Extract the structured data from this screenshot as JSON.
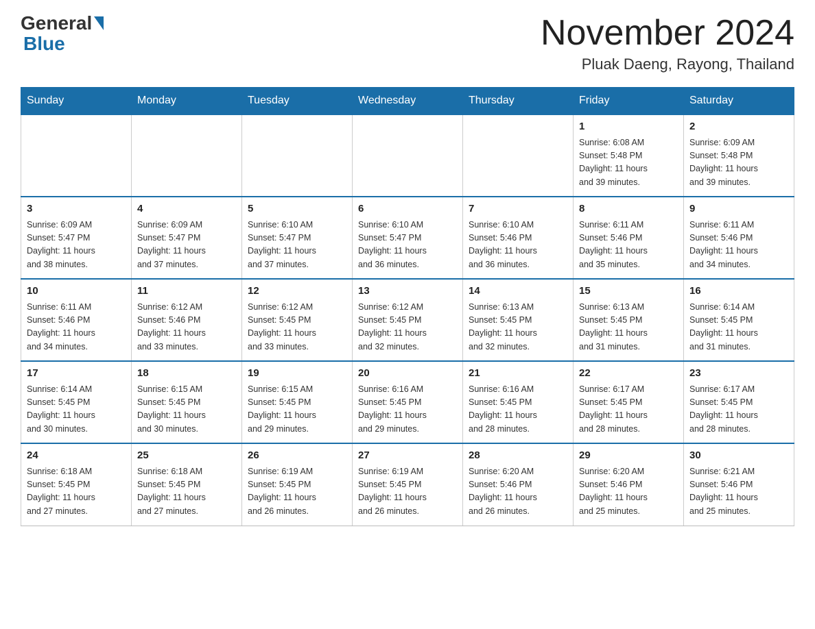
{
  "header": {
    "logo_general": "General",
    "logo_blue": "Blue",
    "month_title": "November 2024",
    "location": "Pluak Daeng, Rayong, Thailand"
  },
  "weekdays": [
    "Sunday",
    "Monday",
    "Tuesday",
    "Wednesday",
    "Thursday",
    "Friday",
    "Saturday"
  ],
  "weeks": [
    [
      {
        "day": "",
        "info": ""
      },
      {
        "day": "",
        "info": ""
      },
      {
        "day": "",
        "info": ""
      },
      {
        "day": "",
        "info": ""
      },
      {
        "day": "",
        "info": ""
      },
      {
        "day": "1",
        "info": "Sunrise: 6:08 AM\nSunset: 5:48 PM\nDaylight: 11 hours\nand 39 minutes."
      },
      {
        "day": "2",
        "info": "Sunrise: 6:09 AM\nSunset: 5:48 PM\nDaylight: 11 hours\nand 39 minutes."
      }
    ],
    [
      {
        "day": "3",
        "info": "Sunrise: 6:09 AM\nSunset: 5:47 PM\nDaylight: 11 hours\nand 38 minutes."
      },
      {
        "day": "4",
        "info": "Sunrise: 6:09 AM\nSunset: 5:47 PM\nDaylight: 11 hours\nand 37 minutes."
      },
      {
        "day": "5",
        "info": "Sunrise: 6:10 AM\nSunset: 5:47 PM\nDaylight: 11 hours\nand 37 minutes."
      },
      {
        "day": "6",
        "info": "Sunrise: 6:10 AM\nSunset: 5:47 PM\nDaylight: 11 hours\nand 36 minutes."
      },
      {
        "day": "7",
        "info": "Sunrise: 6:10 AM\nSunset: 5:46 PM\nDaylight: 11 hours\nand 36 minutes."
      },
      {
        "day": "8",
        "info": "Sunrise: 6:11 AM\nSunset: 5:46 PM\nDaylight: 11 hours\nand 35 minutes."
      },
      {
        "day": "9",
        "info": "Sunrise: 6:11 AM\nSunset: 5:46 PM\nDaylight: 11 hours\nand 34 minutes."
      }
    ],
    [
      {
        "day": "10",
        "info": "Sunrise: 6:11 AM\nSunset: 5:46 PM\nDaylight: 11 hours\nand 34 minutes."
      },
      {
        "day": "11",
        "info": "Sunrise: 6:12 AM\nSunset: 5:46 PM\nDaylight: 11 hours\nand 33 minutes."
      },
      {
        "day": "12",
        "info": "Sunrise: 6:12 AM\nSunset: 5:45 PM\nDaylight: 11 hours\nand 33 minutes."
      },
      {
        "day": "13",
        "info": "Sunrise: 6:12 AM\nSunset: 5:45 PM\nDaylight: 11 hours\nand 32 minutes."
      },
      {
        "day": "14",
        "info": "Sunrise: 6:13 AM\nSunset: 5:45 PM\nDaylight: 11 hours\nand 32 minutes."
      },
      {
        "day": "15",
        "info": "Sunrise: 6:13 AM\nSunset: 5:45 PM\nDaylight: 11 hours\nand 31 minutes."
      },
      {
        "day": "16",
        "info": "Sunrise: 6:14 AM\nSunset: 5:45 PM\nDaylight: 11 hours\nand 31 minutes."
      }
    ],
    [
      {
        "day": "17",
        "info": "Sunrise: 6:14 AM\nSunset: 5:45 PM\nDaylight: 11 hours\nand 30 minutes."
      },
      {
        "day": "18",
        "info": "Sunrise: 6:15 AM\nSunset: 5:45 PM\nDaylight: 11 hours\nand 30 minutes."
      },
      {
        "day": "19",
        "info": "Sunrise: 6:15 AM\nSunset: 5:45 PM\nDaylight: 11 hours\nand 29 minutes."
      },
      {
        "day": "20",
        "info": "Sunrise: 6:16 AM\nSunset: 5:45 PM\nDaylight: 11 hours\nand 29 minutes."
      },
      {
        "day": "21",
        "info": "Sunrise: 6:16 AM\nSunset: 5:45 PM\nDaylight: 11 hours\nand 28 minutes."
      },
      {
        "day": "22",
        "info": "Sunrise: 6:17 AM\nSunset: 5:45 PM\nDaylight: 11 hours\nand 28 minutes."
      },
      {
        "day": "23",
        "info": "Sunrise: 6:17 AM\nSunset: 5:45 PM\nDaylight: 11 hours\nand 28 minutes."
      }
    ],
    [
      {
        "day": "24",
        "info": "Sunrise: 6:18 AM\nSunset: 5:45 PM\nDaylight: 11 hours\nand 27 minutes."
      },
      {
        "day": "25",
        "info": "Sunrise: 6:18 AM\nSunset: 5:45 PM\nDaylight: 11 hours\nand 27 minutes."
      },
      {
        "day": "26",
        "info": "Sunrise: 6:19 AM\nSunset: 5:45 PM\nDaylight: 11 hours\nand 26 minutes."
      },
      {
        "day": "27",
        "info": "Sunrise: 6:19 AM\nSunset: 5:45 PM\nDaylight: 11 hours\nand 26 minutes."
      },
      {
        "day": "28",
        "info": "Sunrise: 6:20 AM\nSunset: 5:46 PM\nDaylight: 11 hours\nand 26 minutes."
      },
      {
        "day": "29",
        "info": "Sunrise: 6:20 AM\nSunset: 5:46 PM\nDaylight: 11 hours\nand 25 minutes."
      },
      {
        "day": "30",
        "info": "Sunrise: 6:21 AM\nSunset: 5:46 PM\nDaylight: 11 hours\nand 25 minutes."
      }
    ]
  ]
}
